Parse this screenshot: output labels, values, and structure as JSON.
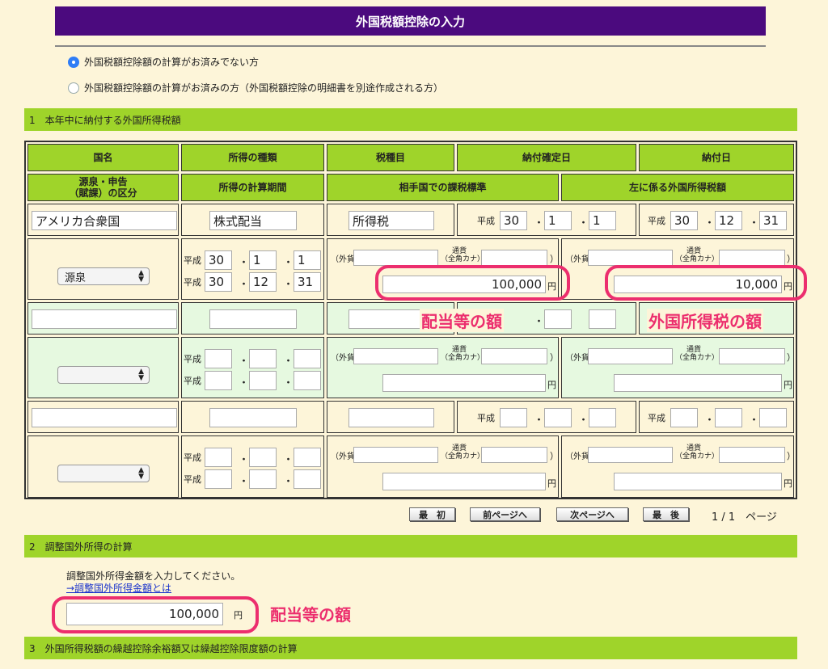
{
  "title": "外国税額控除の入力",
  "radios": [
    {
      "label": "外国税額控除額の計算がお済みでない方",
      "checked": true
    },
    {
      "label": "外国税額控除額の計算がお済みの方（外国税額控除の明細書を別途作成される方）",
      "checked": false
    }
  ],
  "section1": "1　本年中に納付する外国所得税額",
  "headers": {
    "country": "国名",
    "income_type": "所得の種類",
    "tax_item": "税種目",
    "payment_date": "納付確定日",
    "paid_date": "納付日",
    "source_line1": "源泉・申告",
    "source_line2": "（賦課）の区分",
    "calc_period": "所得の計算期間",
    "tax_base": "相手国での課税標準",
    "foreign_tax": "左に係る外国所得税額"
  },
  "labels": {
    "heisei": "平成",
    "gaika": "（外貨",
    "tsuka1": "通貨",
    "tsuka2": "（全角カナ）",
    "paren_close": "）",
    "yen": "円",
    "dot": "・"
  },
  "row1": {
    "country": "アメリカ合衆国",
    "income_type": "株式配当",
    "tax_item": "所得税",
    "payment_date": {
      "y": "30",
      "m": "1",
      "d": "1"
    },
    "paid_date": {
      "y": "30",
      "m": "12",
      "d": "31"
    },
    "source": "源泉",
    "period_from": {
      "y": "30",
      "m": "1",
      "d": "1"
    },
    "period_to": {
      "y": "30",
      "m": "12",
      "d": "31"
    },
    "tax_base_yen": "100,000",
    "foreign_tax_yen": "10,000"
  },
  "nav": {
    "first": "最　初",
    "prev": "前ページへ",
    "next": "次ページへ",
    "last": "最　後",
    "page_info": "1 / 1　ページ"
  },
  "section2": "2　調整国外所得の計算",
  "section2_instruction": "調整国外所得金額を入力してください。",
  "section2_link": "→調整国外所得金額とは",
  "section2_value": "100,000",
  "section3": "3　外国所得税額の繰越控除余裕額又は繰越控除限度額の計算",
  "annotations": {
    "dividend_amount": "配当等の額",
    "foreign_tax_amount": "外国所得税の額",
    "dividend_amount2": "配当等の額",
    "color": "#ec2e6e"
  }
}
